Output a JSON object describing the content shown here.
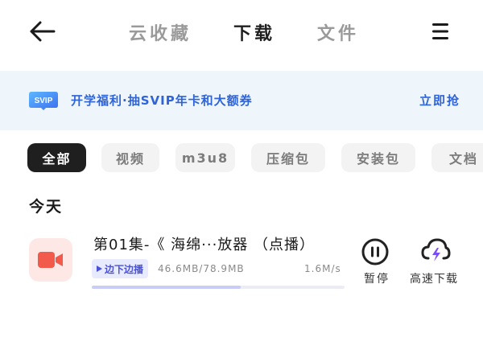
{
  "header": {
    "tabs": [
      {
        "label": "云收藏",
        "active": false
      },
      {
        "label": "下载",
        "active": true
      },
      {
        "label": "文件",
        "active": false
      }
    ]
  },
  "banner": {
    "badge": "SVIP",
    "text": "开学福利·抽SVIP年卡和大额券",
    "action": "立即抢"
  },
  "filters": [
    {
      "label": "全部",
      "active": true
    },
    {
      "label": "视频",
      "active": false
    },
    {
      "label": "m3u8",
      "active": false
    },
    {
      "label": "压缩包",
      "active": false
    },
    {
      "label": "安装包",
      "active": false
    },
    {
      "label": "文档",
      "active": false
    }
  ],
  "section": {
    "title": "今天"
  },
  "downloads": [
    {
      "title": "第01集-《 海绵···放器 （点播）",
      "play_tag": "边下边播",
      "size": "46.6MB/78.9MB",
      "speed": "1.6M/s",
      "progress": 0.59,
      "pause_label": "暂停",
      "fast_label": "高速下载"
    }
  ],
  "colors": {
    "accent": "#2f64d8",
    "chip_active": "#1f1f1f",
    "chip_inactive": "#f3f3f3",
    "banner_bg": "#eef6fc",
    "progress_fill": "#c9ccf4",
    "thumb_bg": "#fde8e6",
    "thumb_icon": "#f25b4c"
  },
  "icons": {
    "back": "arrow-left-icon",
    "menu": "hamburger-menu-icon",
    "thumb": "video-camera-icon",
    "pause": "pause-icon",
    "fast": "cloud-lightning-icon"
  }
}
